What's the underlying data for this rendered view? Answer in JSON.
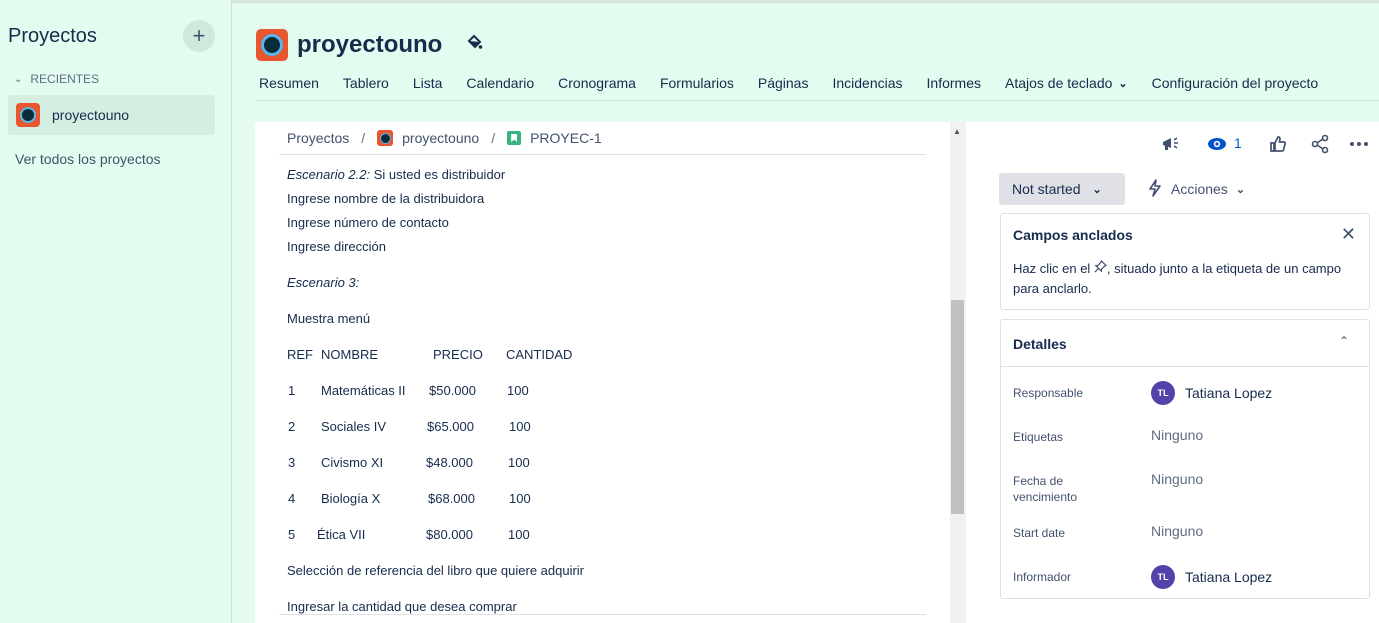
{
  "sidebar": {
    "title": "Proyectos",
    "add_label": "+",
    "recent_label": "RECIENTES",
    "recent_item": "proyectouno",
    "view_all": "Ver todos los proyectos"
  },
  "header": {
    "project_name": "proyectouno",
    "tabs": [
      "Resumen",
      "Tablero",
      "Lista",
      "Calendario",
      "Cronograma",
      "Formularios",
      "Páginas",
      "Incidencias",
      "Informes",
      "Atajos de teclado",
      "Configuración del proyecto"
    ]
  },
  "breadcrumb": {
    "root": "Proyectos",
    "project": "proyectouno",
    "issue": "PROYEC-1",
    "sep": "/"
  },
  "doc": {
    "esc22_label": "Escenario 2.2:",
    "esc22_text": " Si usted es distribuidor",
    "l1": "Ingrese nombre de la distribuidora",
    "l2": "Ingrese número de contacto",
    "l3": "Ingrese dirección",
    "esc3": "Escenario 3:",
    "menu": "Muestra menú",
    "table": {
      "headers": [
        "REF",
        "NOMBRE",
        "PRECIO",
        "CANTIDAD"
      ],
      "rows": [
        [
          "1",
          "Matemáticas II",
          "$50.000",
          "100"
        ],
        [
          "2",
          "Sociales  IV",
          "$65.000",
          "100"
        ],
        [
          "3",
          "Civismo  XI",
          "$48.000",
          "100"
        ],
        [
          "4",
          "Biología X",
          "$68.000",
          "100"
        ],
        [
          "5",
          "Ética  VII",
          "$80.000",
          "100"
        ]
      ]
    },
    "sel": "Selección de referencia del libro que quiere adquirir",
    "qty": "Ingresar la cantidad que desea comprar"
  },
  "right": {
    "watch_count": "1",
    "status": "Not started",
    "actions": "Acciones",
    "pinned": {
      "title": "Campos anclados",
      "text_before": "Haz clic en el ",
      "text_after": ", situado junto a la etiqueta de un campo para anclarlo."
    },
    "details": {
      "title": "Detalles",
      "assignee_label": "Responsable",
      "assignee": "Tatiana Lopez",
      "assignee_initials": "TL",
      "labels_label": "Etiquetas",
      "labels_val": "Ninguno",
      "due_label": "Fecha de vencimiento",
      "due_val": "Ninguno",
      "start_label": "Start date",
      "start_val": "Ninguno",
      "reporter_label": "Informador",
      "reporter": "Tatiana Lopez",
      "reporter_initials": "TL"
    }
  },
  "colors": {
    "sidebar_bg": "#e3fcef",
    "project_icon": "#e8552f",
    "avatar": "#5243aa",
    "issue_icon": "#36b37e",
    "accent": "#4c9aff"
  }
}
